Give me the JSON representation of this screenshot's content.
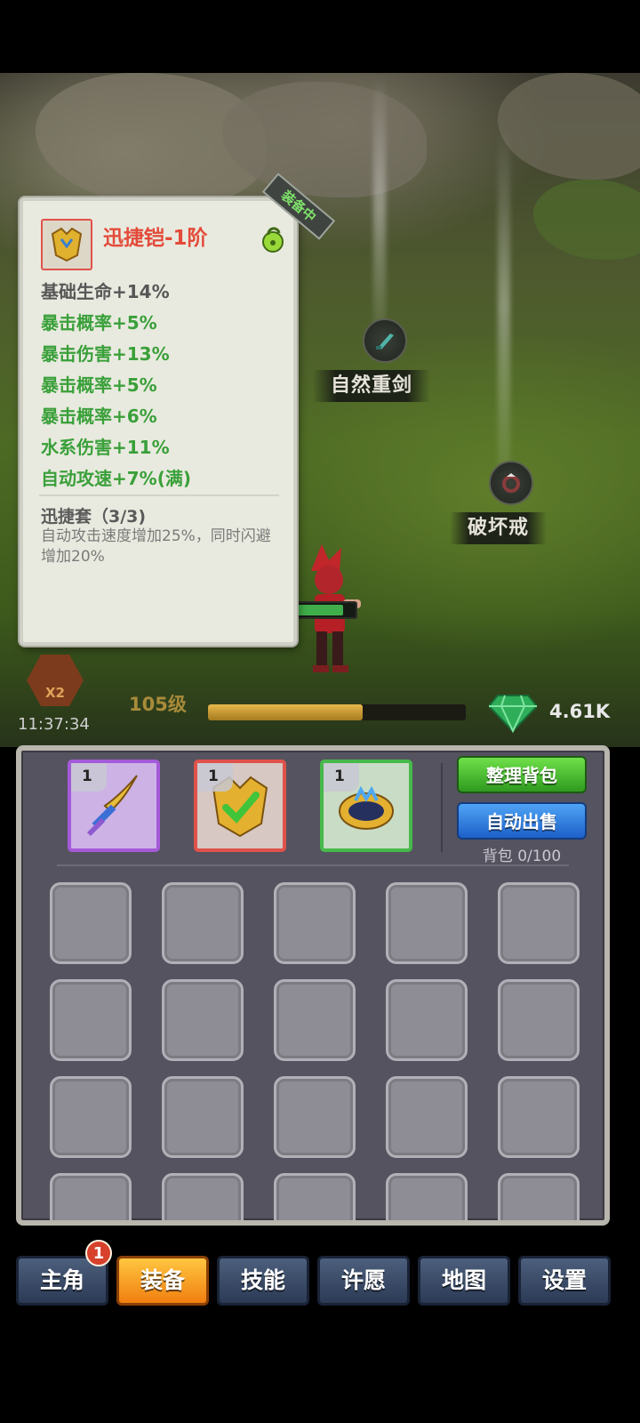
{
  "scene": {
    "drops": [
      {
        "name": "自然重剑",
        "icon": "greatsword-icon"
      },
      {
        "name": "破坏戒",
        "icon": "ring-icon"
      }
    ]
  },
  "tooltip": {
    "title": "迅捷铠-1阶",
    "equipped_badge": "装备中",
    "item_icon": "golden-armor-icon",
    "lock_icon": "lock-icon",
    "base_stat": "基础生命+14%",
    "bonus_stats": [
      "暴击概率+5%",
      "暴击伤害+13%",
      "暴击概率+5%",
      "暴击概率+6%",
      "水系伤害+11%",
      "自动攻速+7%(满)"
    ],
    "set_name": "迅捷套（3/3)",
    "set_description": "自动攻击速度增加25%，同时闪避增加20%"
  },
  "hud": {
    "multiplier": "X2",
    "clock": "11:37:34",
    "level": "105级",
    "xp_fraction": 0.6,
    "gems": "4.61K",
    "hp_fraction": 0.85
  },
  "inventory": {
    "equipped": [
      {
        "level": "1",
        "icon": "golden-sword-icon",
        "rarity": "purple"
      },
      {
        "level": "1",
        "icon": "golden-armor-icon",
        "rarity": "red",
        "selected": true
      },
      {
        "level": "1",
        "icon": "crown-icon",
        "rarity": "green"
      }
    ],
    "sort_button": "整理背包",
    "auto_sell_button": "自动出售",
    "bag_capacity": "背包 0/100"
  },
  "nav": {
    "items": [
      "主角",
      "装备",
      "技能",
      "许愿",
      "地图",
      "设置"
    ],
    "active": 1,
    "badge": "1"
  },
  "colors": {
    "title_red": "#e34b3b",
    "stat_green": "#3aa03a",
    "nav_active": "#f5a020"
  }
}
